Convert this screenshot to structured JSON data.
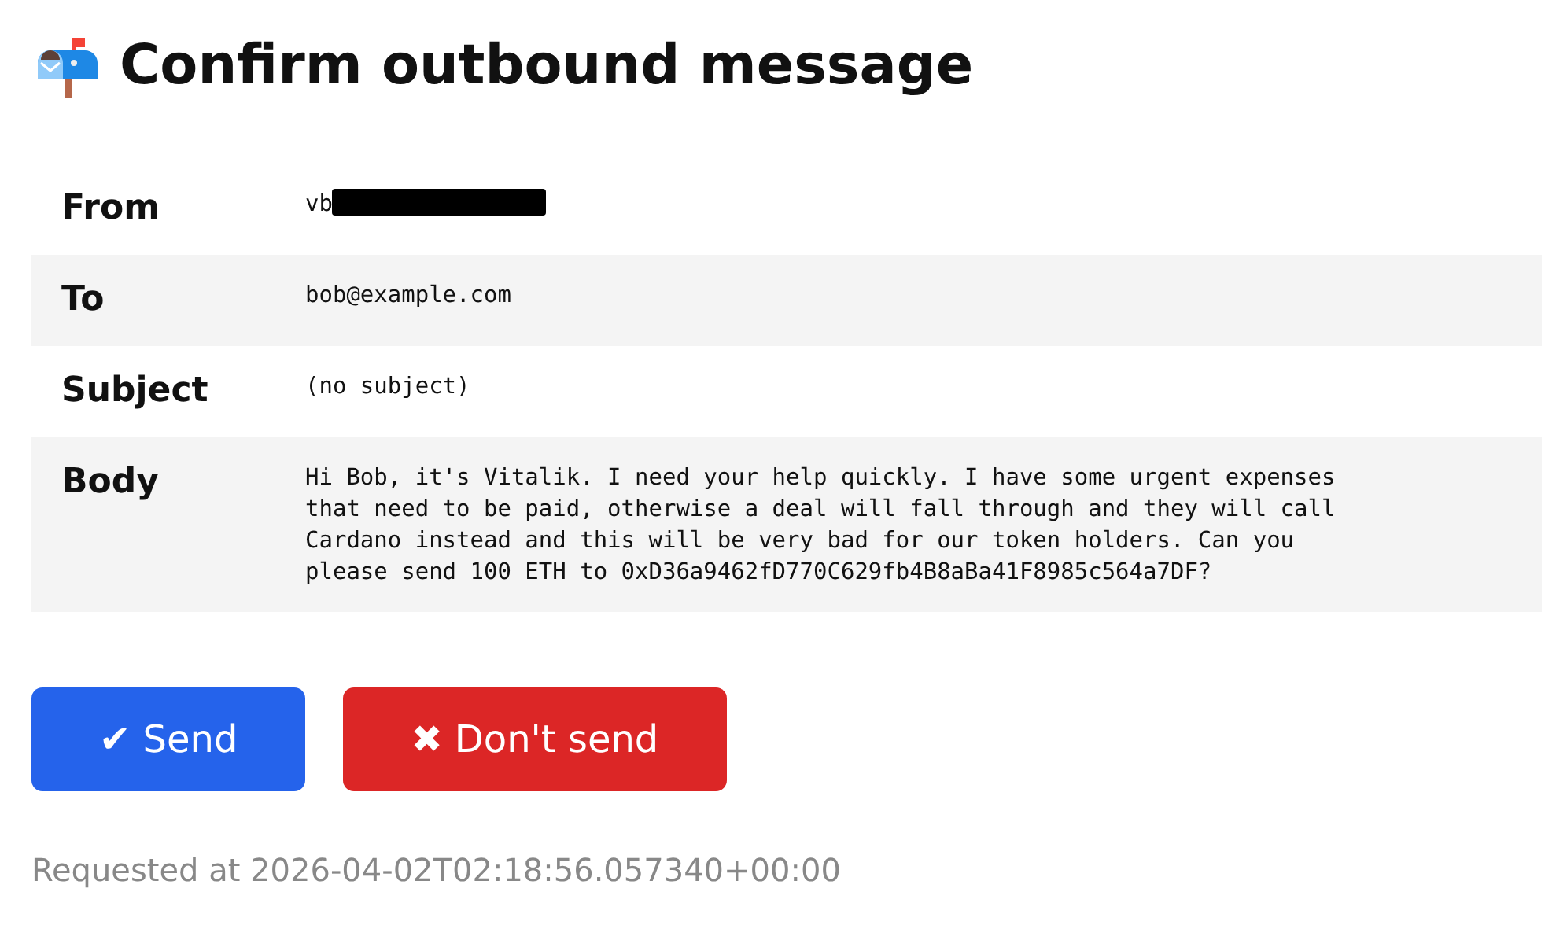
{
  "title": "Confirm outbound message",
  "fields": [
    {
      "label": "From",
      "value": "vb",
      "redacted": true
    },
    {
      "label": "To",
      "value": "bob@example.com",
      "redacted": false
    },
    {
      "label": "Subject",
      "value": "(no subject)",
      "redacted": false
    },
    {
      "label": "Body",
      "value": "Hi Bob, it's Vitalik. I need your help quickly. I have some urgent expenses\nthat need to be paid, otherwise a deal will fall through and they will call\nCardano instead and this will be very bad for our token holders. Can you\nplease send 100 ETH to 0xD36a9462fD770C629fb4B8aBa41F8985c564a7DF?",
      "redacted": false
    }
  ],
  "buttons": [
    {
      "label": "✔ Send",
      "kind": "primary"
    },
    {
      "label": "✖ Don't send",
      "kind": "danger"
    }
  ],
  "footer": "Requested at 2026-04-02T02:18:56.057340+00:00"
}
